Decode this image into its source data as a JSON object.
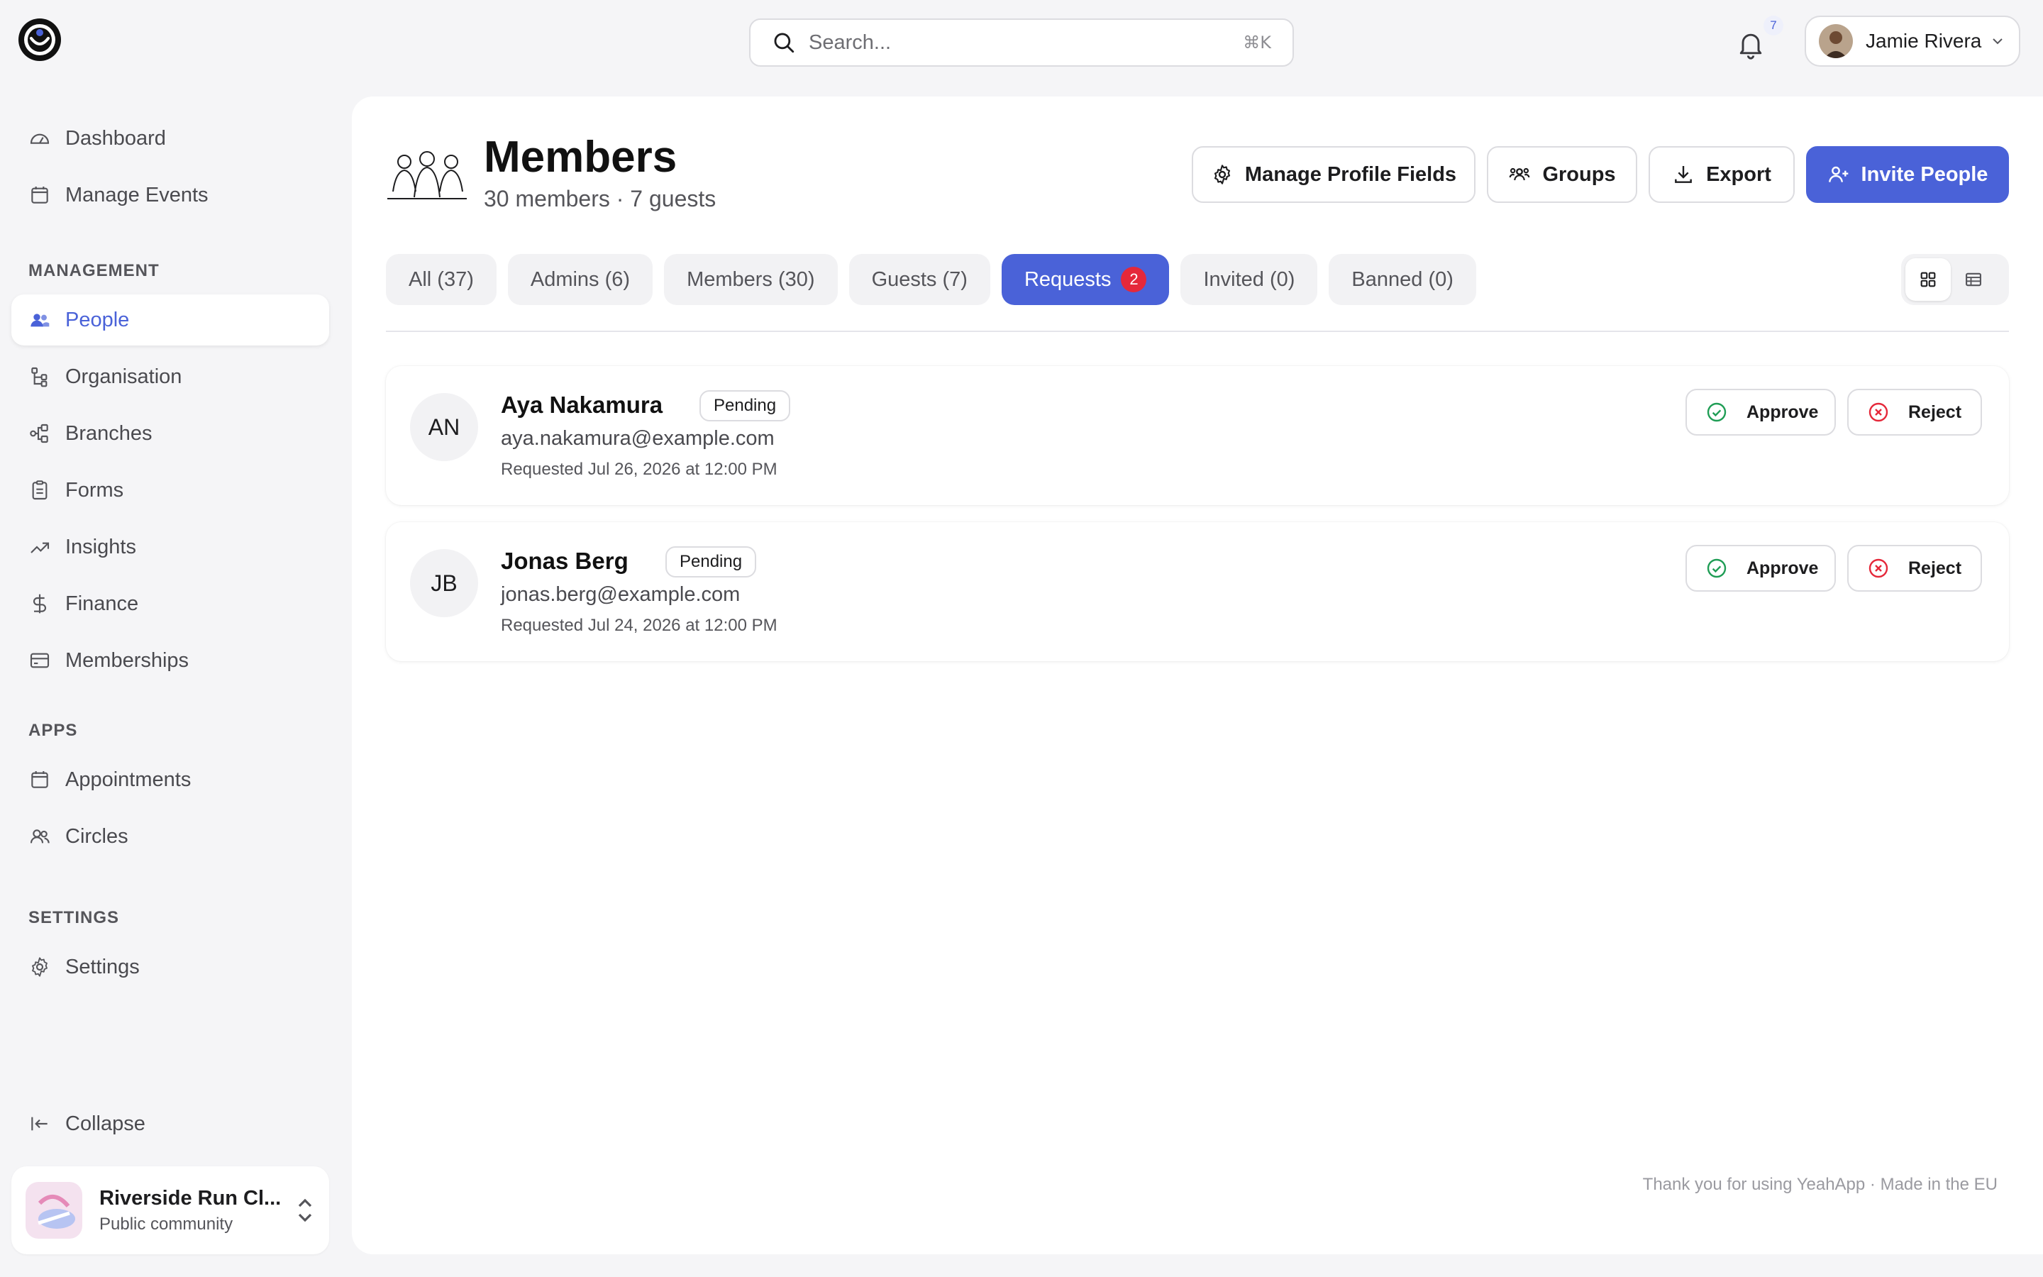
{
  "search": {
    "placeholder": "Search...",
    "shortcut": "⌘K"
  },
  "notifications": {
    "count": "7"
  },
  "user": {
    "name": "Jamie Rivera"
  },
  "sidebar": {
    "top_items": [
      {
        "label": "Dashboard",
        "icon": "gauge-icon"
      },
      {
        "label": "Manage Events",
        "icon": "calendar-icon"
      }
    ],
    "management_label": "MANAGEMENT",
    "management_items": [
      {
        "label": "People",
        "icon": "people-icon",
        "active": true
      },
      {
        "label": "Organisation",
        "icon": "org-tree-icon"
      },
      {
        "label": "Branches",
        "icon": "branches-icon"
      },
      {
        "label": "Forms",
        "icon": "clipboard-icon"
      },
      {
        "label": "Insights",
        "icon": "trend-icon"
      },
      {
        "label": "Finance",
        "icon": "dollar-icon"
      },
      {
        "label": "Memberships",
        "icon": "card-icon"
      }
    ],
    "apps_label": "APPS",
    "apps_items": [
      {
        "label": "Appointments",
        "icon": "calendar-icon"
      },
      {
        "label": "Circles",
        "icon": "circles-icon"
      }
    ],
    "settings_label": "SETTINGS",
    "settings_items": [
      {
        "label": "Settings",
        "icon": "gear-icon"
      }
    ],
    "collapse_label": "Collapse",
    "community": {
      "name": "Riverside Run Cl...",
      "type": "Public community"
    }
  },
  "header": {
    "title": "Members",
    "subtitle": "30 members · 7 guests",
    "buttons": {
      "manage_fields": "Manage Profile Fields",
      "groups": "Groups",
      "export": "Export",
      "invite": "Invite People"
    }
  },
  "tabs": [
    {
      "label": "All (37)"
    },
    {
      "label": "Admins (6)"
    },
    {
      "label": "Members (30)"
    },
    {
      "label": "Guests (7)"
    },
    {
      "label": "Requests",
      "count": "2",
      "active": true
    },
    {
      "label": "Invited (0)"
    },
    {
      "label": "Banned (0)"
    }
  ],
  "requests": [
    {
      "initials": "AN",
      "name": "Aya Nakamura",
      "status": "Pending",
      "email": "aya.nakamura@example.com",
      "requested": "Requested Jul 26, 2026 at 12:00 PM",
      "approve_label": "Approve",
      "reject_label": "Reject"
    },
    {
      "initials": "JB",
      "name": "Jonas Berg",
      "status": "Pending",
      "email": "jonas.berg@example.com",
      "requested": "Requested Jul 24, 2026 at 12:00 PM",
      "approve_label": "Approve",
      "reject_label": "Reject"
    }
  ],
  "footer": {
    "text": "Thank you for using YeahApp · Made in the EU"
  },
  "colors": {
    "accent": "#4a62d8",
    "danger": "#e5283a",
    "success": "#1f9d55"
  }
}
